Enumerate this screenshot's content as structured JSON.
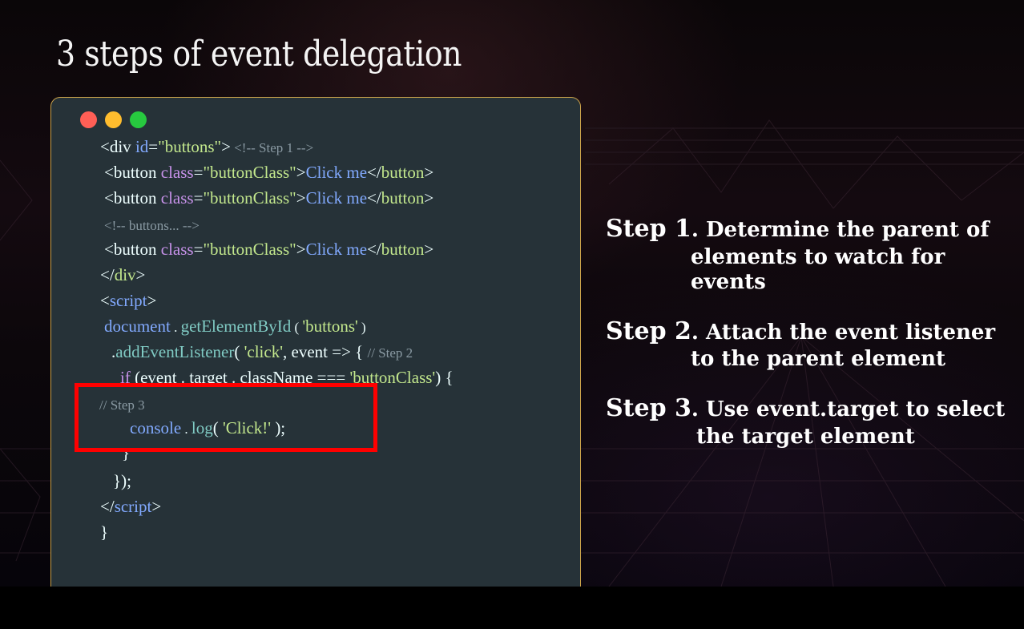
{
  "title": "3 steps of event delegation",
  "code": {
    "lines": {
      "l1": {
        "a": "<div ",
        "b": "id",
        "c": "=",
        "d": "\"buttons\"",
        "e": ">",
        "f": " <!-- Step 1 -->"
      },
      "l2": {
        "a": "<button ",
        "b": "class",
        "c": "=",
        "d": "\"buttonClass\"",
        "e": ">",
        "f": "Click me",
        "g": "</",
        "h": "button",
        "i": ">"
      },
      "l3": {
        "a": "<button ",
        "b": "class",
        "c": "=",
        "d": "\"buttonClass\"",
        "e": ">",
        "f": "Click me",
        "g": "</",
        "h": "button",
        "i": ">"
      },
      "l4": {
        "a": "<!-- buttons... -->"
      },
      "l5": {
        "a": "<button ",
        "b": "class",
        "c": "=",
        "d": "\"buttonClass\"",
        "e": ">",
        "f": "Click me",
        "g": "</",
        "h": "button",
        "i": ">"
      },
      "l6": {
        "a": "</",
        "b": "div",
        "c": ">"
      },
      "l7": {
        "a": "<",
        "b": "script",
        "c": ">"
      },
      "l8": {
        "a": "document",
        "b": " . ",
        "c": "getElementById",
        "d": " ( ",
        "e": "'buttons'",
        "f": " )"
      },
      "l9": {
        "a": ".",
        "b": "addEventListener",
        "c": "( ",
        "d": "'click'",
        "e": ", event => { ",
        "f": "// Step 2"
      },
      "l10": {
        "a": "if",
        "b": " (event . target . className === ",
        "c": "'buttonClass'",
        "d": ") {"
      },
      "l11": {
        "a": "// Step 3"
      },
      "l12": {
        "a": "console",
        "b": " . ",
        "c": "log",
        "d": "( ",
        "e": "'Click!'",
        "f": " );"
      },
      "l13": {
        "a": "}"
      },
      "l14": {
        "a": "});"
      },
      "l15": {
        "a": "</",
        "b": "script",
        "c": ">"
      },
      "l16": {
        "a": "}"
      }
    }
  },
  "steps": [
    {
      "label": "Step 1",
      "line1": ". Determine the parent of",
      "line2": "elements to watch for",
      "line3": "events"
    },
    {
      "label": "Step 2",
      "line1": ". Attach the event listener",
      "line2": "to the  parent element"
    },
    {
      "label": "Step 3",
      "line1": ". Use event.target to select",
      "line2": "the target element"
    }
  ],
  "colors": {
    "highlight": "#ff0000",
    "window_border": "#c9a24a",
    "code_bg": "#263238"
  }
}
